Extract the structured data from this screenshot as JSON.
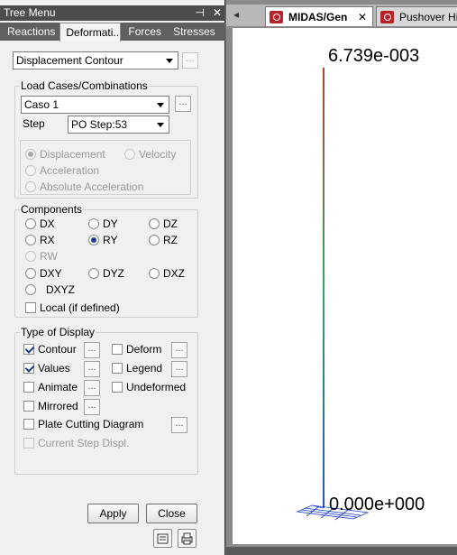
{
  "panel": {
    "title": "Tree Menu",
    "title_buttons": {
      "pin": "⊣",
      "close": "✕"
    },
    "tabs": [
      {
        "label": "Reactions"
      },
      {
        "label": "Deformati..."
      },
      {
        "label": "Forces"
      },
      {
        "label": "Stresses"
      }
    ],
    "result_type": {
      "value": "Displacement Contour",
      "more": "..."
    },
    "load_cases": {
      "group_label": "Load Cases/Combinations",
      "value": "Caso 1",
      "more": "...",
      "step_label": "Step",
      "step_value": "PO Step:53"
    },
    "motion": {
      "displacement": "Displacement",
      "velocity": "Velocity",
      "acceleration": "Acceleration",
      "absolute_acceleration": "Absolute Acceleration"
    },
    "components": {
      "group_label": "Components",
      "items": [
        "DX",
        "DY",
        "DZ",
        "RX",
        "RY",
        "RZ",
        "RW",
        "DXY",
        "DYZ",
        "DXZ",
        "DXYZ"
      ],
      "selected": "RY",
      "local_label": "Local (if defined)"
    },
    "display": {
      "group_label": "Type of Display",
      "contour": "Contour",
      "deform": "Deform",
      "values": "Values",
      "legend": "Legend",
      "animate": "Animate",
      "undeformed": "Undeformed",
      "mirrored": "Mirrored",
      "plate_cutting": "Plate Cutting Diagram",
      "current_step": "Current Step Displ.",
      "more": "..."
    },
    "buttons": {
      "apply": "Apply",
      "close": "Close"
    }
  },
  "view": {
    "tabs": [
      {
        "label": "MIDAS/Gen",
        "close": "✕"
      },
      {
        "label": "Pushover Hi"
      }
    ],
    "scroll_left": "◂",
    "max_label": "6.739e-003",
    "min_label": "0.000e+000",
    "colors": {
      "contour_top": "#c0392b",
      "contour_mid": "#27ae60",
      "contour_bottom": "#1f4fd1"
    }
  }
}
